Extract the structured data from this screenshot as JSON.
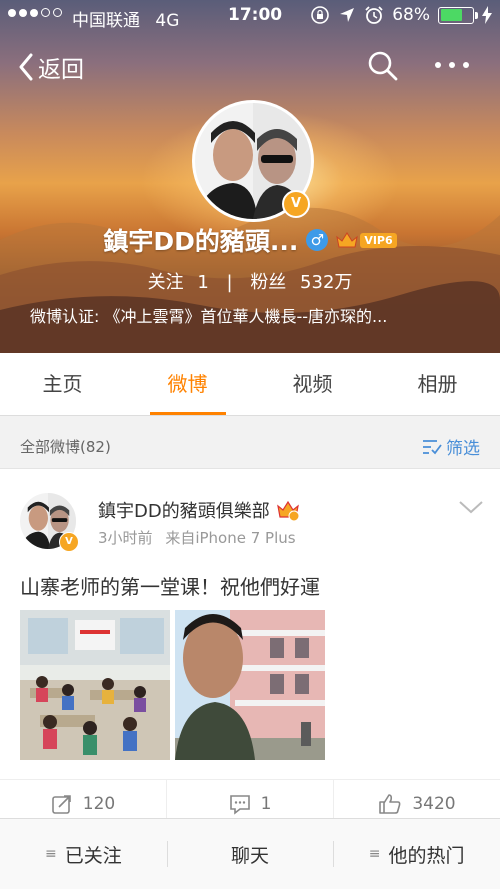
{
  "status_bar": {
    "carrier": "中国联通",
    "network": "4G",
    "time": "17:00",
    "battery": "68%",
    "battery_level": 0.68
  },
  "nav": {
    "back_label": "返回"
  },
  "profile": {
    "name": "鎮宇DD的豬頭...",
    "vip_label": "VIP6",
    "following_label": "关注",
    "following_count": "1",
    "followers_label": "粉丝",
    "followers_count": "532万",
    "verification": "微博认证: 《冲上雲霄》首位華人機長--唐亦琛的..."
  },
  "tabs": [
    {
      "label": "主页",
      "active": false
    },
    {
      "label": "微博",
      "active": true
    },
    {
      "label": "视频",
      "active": false
    },
    {
      "label": "相册",
      "active": false
    }
  ],
  "filter_bar": {
    "all_label": "全部微博(82)",
    "filter_label": "筛选"
  },
  "post": {
    "author": "鎮宇DD的豬頭俱樂部",
    "time": "3小时前",
    "source": "来自iPhone 7 Plus",
    "text": "山寨老师的第一堂课！祝他們好運",
    "reposts": "120",
    "comments": "1",
    "likes": "3420"
  },
  "bottom_bar": {
    "following_label": "已关注",
    "chat_label": "聊天",
    "hot_label": "他的热门"
  },
  "colors": {
    "accent": "#ff8200",
    "link_blue": "#4a8fd8",
    "verify_gold": "#f6a623"
  }
}
